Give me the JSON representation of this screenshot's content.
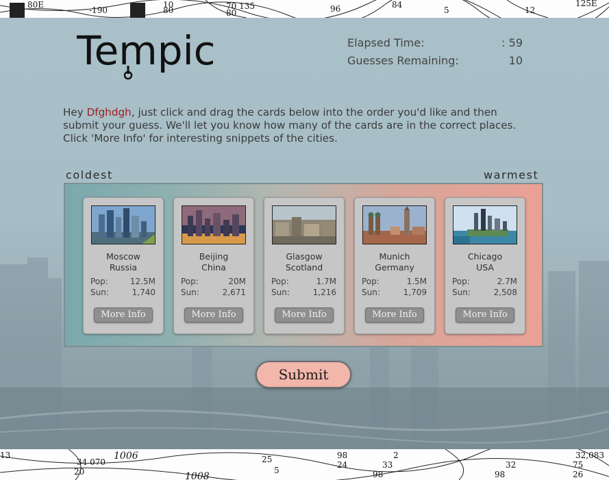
{
  "app": {
    "logo_text": "Tempic"
  },
  "stats": {
    "elapsed_label": "Elapsed Time:",
    "elapsed_value": ": 59",
    "guesses_label": "Guesses Remaining:",
    "guesses_value": "10"
  },
  "intro": {
    "greeting": "Hey ",
    "username": "Dfghdgh",
    "message": ", just click and drag the cards below into the order you'd like and then submit your guess. We'll let you know how many of the cards are in the correct places. Click 'More Info' for interesting snippets of the cities."
  },
  "scale": {
    "cold_label": "coldest",
    "warm_label": "warmest"
  },
  "cards": [
    {
      "city": "Moscow",
      "country": "Russia",
      "pop_label": "Pop:",
      "pop": "12.5M",
      "sun_label": "Sun:",
      "sun": "1,740",
      "button": "More Info",
      "photo_icon": "moscow-skyline-photo"
    },
    {
      "city": "Beijing",
      "country": "China",
      "pop_label": "Pop:",
      "pop": "20M",
      "sun_label": "Sun:",
      "sun": "2,671",
      "button": "More Info",
      "photo_icon": "beijing-skyline-photo"
    },
    {
      "city": "Glasgow",
      "country": "Scotland",
      "pop_label": "Pop:",
      "pop": "1.7M",
      "sun_label": "Sun:",
      "sun": "1,216",
      "button": "More Info",
      "photo_icon": "glasgow-cityscape-photo"
    },
    {
      "city": "Munich",
      "country": "Germany",
      "pop_label": "Pop:",
      "pop": "1.5M",
      "sun_label": "Sun:",
      "sun": "1,709",
      "button": "More Info",
      "photo_icon": "munich-cathedral-photo"
    },
    {
      "city": "Chicago",
      "country": "USA",
      "pop_label": "Pop:",
      "pop": "2.7M",
      "sun_label": "Sun:",
      "sun": "2,508",
      "button": "More Info",
      "photo_icon": "chicago-lakefront-photo"
    }
  ],
  "submit_label": "Submit",
  "colors": {
    "username": "#9a1e1e",
    "tray_cold": "#7aa9ad",
    "tray_warm": "#eba195",
    "submit_bg": "#f3b6aa",
    "card_bg": "#c6c6c6"
  },
  "weather_map": {
    "top_labels": [
      "80E",
      "-190",
      "10",
      "80",
      "70 135",
      "80 ",
      "96",
      "84",
      "5",
      "12",
      "125E"
    ],
    "bottom_labels": [
      "13",
      "34 070",
      "20",
      "1006",
      "25",
      "5",
      "98",
      "24",
      "33",
      "98",
      "2",
      "1008",
      "32",
      "98",
      "75",
      "26",
      "32,083"
    ]
  }
}
